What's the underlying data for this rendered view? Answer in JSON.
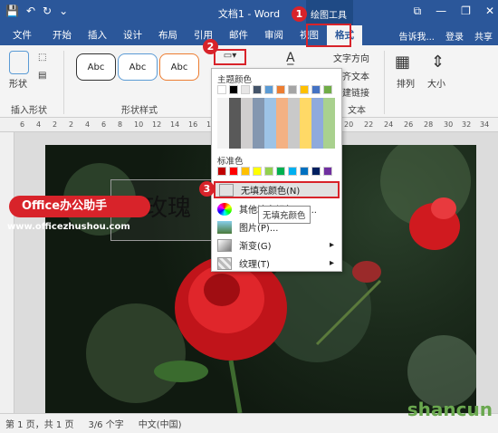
{
  "window": {
    "title": "文档1 - Word",
    "context_tab": "绘图工具"
  },
  "ribbon_tabs": [
    "文件",
    "开始",
    "插入",
    "设计",
    "布局",
    "引用",
    "邮件",
    "审阅",
    "视图",
    "格式"
  ],
  "ribbon_right": {
    "tell_me": "告诉我...",
    "login": "登录",
    "share": "共享"
  },
  "ribbon": {
    "shape_label": "形状",
    "insert_shapes_group": "插入形状",
    "shape_styles_group": "形状样式",
    "abc": [
      "Abc",
      "Abc",
      "Abc"
    ],
    "text_direction": "文字方向",
    "align_text": "对齐文本",
    "create_link": "创建链接",
    "text_group": "文本",
    "arrange": "排列",
    "size": "大小"
  },
  "ruler_ticks": [
    "6",
    "4",
    "2",
    "2",
    "4",
    "6",
    "8",
    "10",
    "12",
    "14",
    "16",
    "18",
    "20",
    "22",
    "24",
    "26",
    "28",
    "30",
    "32",
    "34"
  ],
  "textbox_text": "红玫瑰",
  "menu": {
    "theme_colors": "主题颜色",
    "standard_colors": "标准色",
    "no_fill": "无填充颜色(N)",
    "more_colors": "其他填充颜色(M)...",
    "picture": "图片(P)...",
    "gradient": "渐变(G)",
    "texture": "纹理(T)"
  },
  "tooltip": "无填充颜色",
  "callouts": [
    "1",
    "2",
    "3"
  ],
  "watermark": {
    "badge": "Office办公助手",
    "url": "www.officezhushou.com"
  },
  "status": {
    "page": "第 1 页，共 1 页",
    "words": "3/6 个字",
    "lang": "中文(中国)"
  },
  "logo": "shancun",
  "colors": {
    "word_blue": "#2b579a",
    "accent_red": "#d8232a",
    "theme_palette": [
      "#ffffff",
      "#000000",
      "#e7e6e6",
      "#44546a",
      "#5b9bd5",
      "#ed7d31",
      "#a5a5a5",
      "#ffc000",
      "#4472c4",
      "#70ad47"
    ],
    "standard_palette": [
      "#c00000",
      "#ff0000",
      "#ffc000",
      "#ffff00",
      "#92d050",
      "#00b050",
      "#00b0f0",
      "#0070c0",
      "#002060",
      "#7030a0"
    ]
  }
}
